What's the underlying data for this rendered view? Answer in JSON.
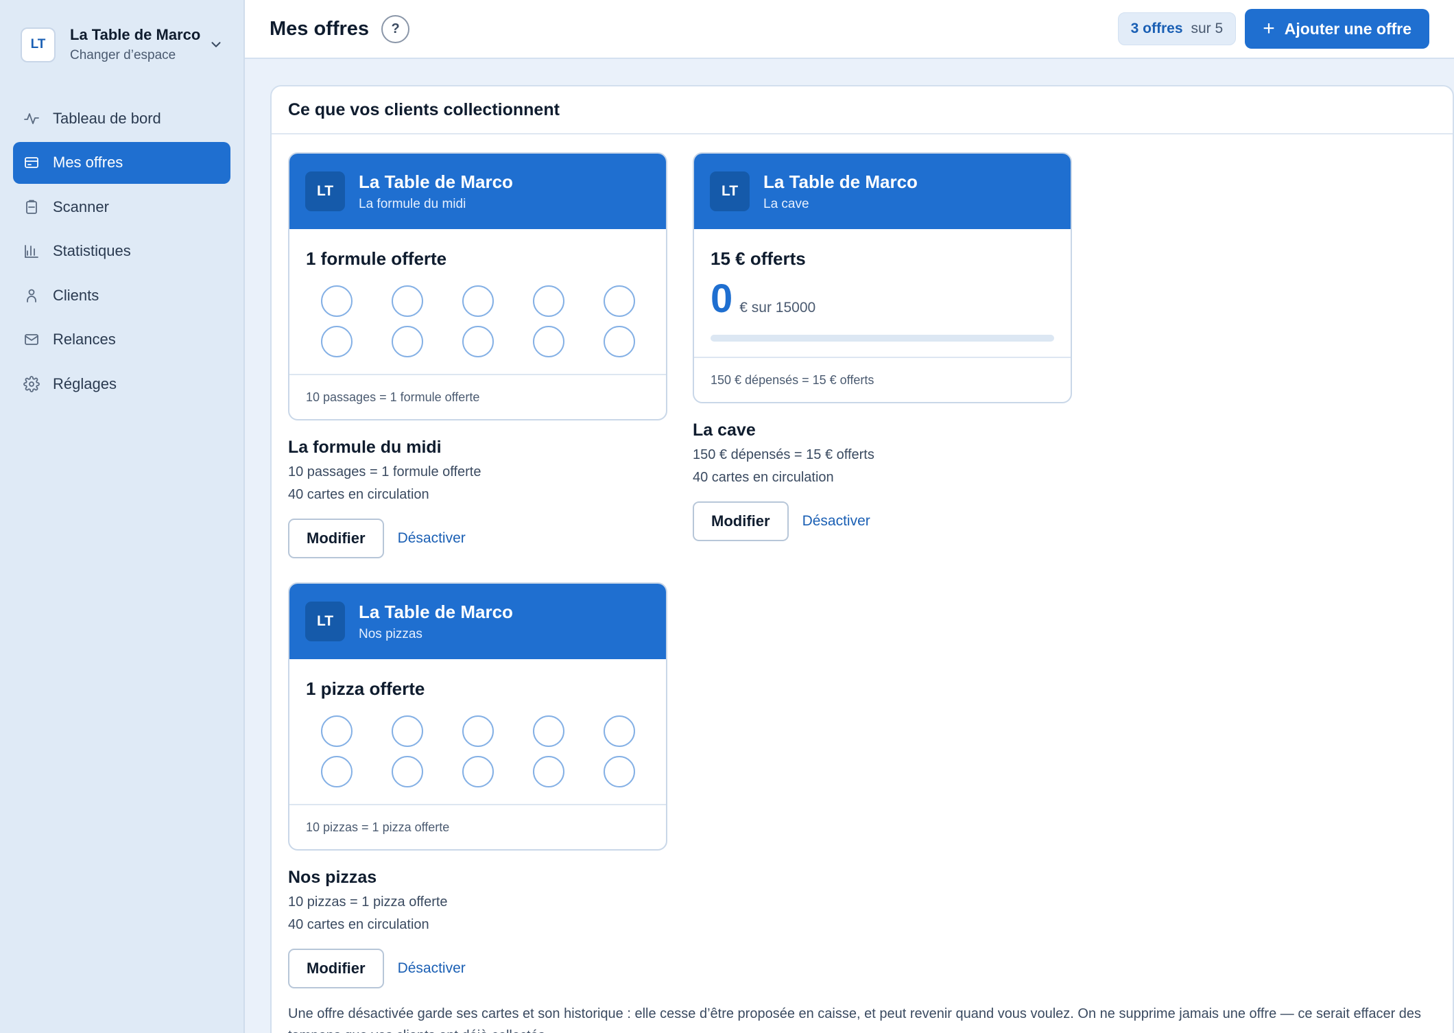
{
  "workspace": {
    "badge": "LT",
    "name": "La Table de Marco",
    "switch_label": "Changer d’espace"
  },
  "nav": [
    {
      "label": "Tableau de bord",
      "icon": "activity-icon"
    },
    {
      "label": "Mes offres",
      "icon": "card-icon",
      "active": true
    },
    {
      "label": "Scanner",
      "icon": "scanner-icon"
    },
    {
      "label": "Statistiques",
      "icon": "bar-chart-icon"
    },
    {
      "label": "Clients",
      "icon": "user-icon"
    },
    {
      "label": "Relances",
      "icon": "mail-icon"
    },
    {
      "label": "Réglages",
      "icon": "gear-icon"
    }
  ],
  "header": {
    "title": "Mes offres",
    "help": "?",
    "quota_count": "3 offres",
    "quota_total": "sur 5",
    "add_label": "Ajouter une offre"
  },
  "panel": {
    "title": "Ce que vos clients collectionnent"
  },
  "offers": [
    {
      "card_badge": "LT",
      "card_brand": "La Table de Marco",
      "card_sub": "La formule du midi",
      "reward": "1 formule offerte",
      "stamps_total": 10,
      "stamps_filled": 0,
      "card_footer": "10 passages = 1 formule offerte",
      "title": "La formule du midi",
      "rule": "10 passages = 1 formule offerte",
      "circulation": "40 cartes en circulation",
      "modify_label": "Modifier",
      "disable_label": "Désactiver"
    },
    {
      "card_badge": "LT",
      "card_brand": "La Table de Marco",
      "card_sub": "La cave",
      "reward": "15 € offerts",
      "amount": "0",
      "amount_of": "€ sur 15000",
      "progress": 0,
      "card_footer": "150 € dépensés = 15 € offerts",
      "title": "La cave",
      "rule": "150 € dépensés = 15 € offerts",
      "circulation": "40 cartes en circulation",
      "modify_label": "Modifier",
      "disable_label": "Désactiver"
    },
    {
      "card_badge": "LT",
      "card_brand": "La Table de Marco",
      "card_sub": "Nos pizzas",
      "reward": "1 pizza offerte",
      "stamps_total": 10,
      "stamps_filled": 0,
      "card_footer": "10 pizzas = 1 pizza offerte",
      "title": "Nos pizzas",
      "rule": "10 pizzas = 1 pizza offerte",
      "circulation": "40 cartes en circulation",
      "modify_label": "Modifier",
      "disable_label": "Désactiver"
    }
  ],
  "note": "Une offre désactivée garde ses cartes et son historique : elle cesse d’être proposée en caisse, et peut revenir quand vous voulez. On ne supprime jamais une offre — ce serait effacer des tampons que vos clients ont déjà collectés.",
  "colors": {
    "accent": "#1f6fd0",
    "sidebar_bg": "#dfeaf6",
    "page_bg": "#eaf1fa"
  }
}
